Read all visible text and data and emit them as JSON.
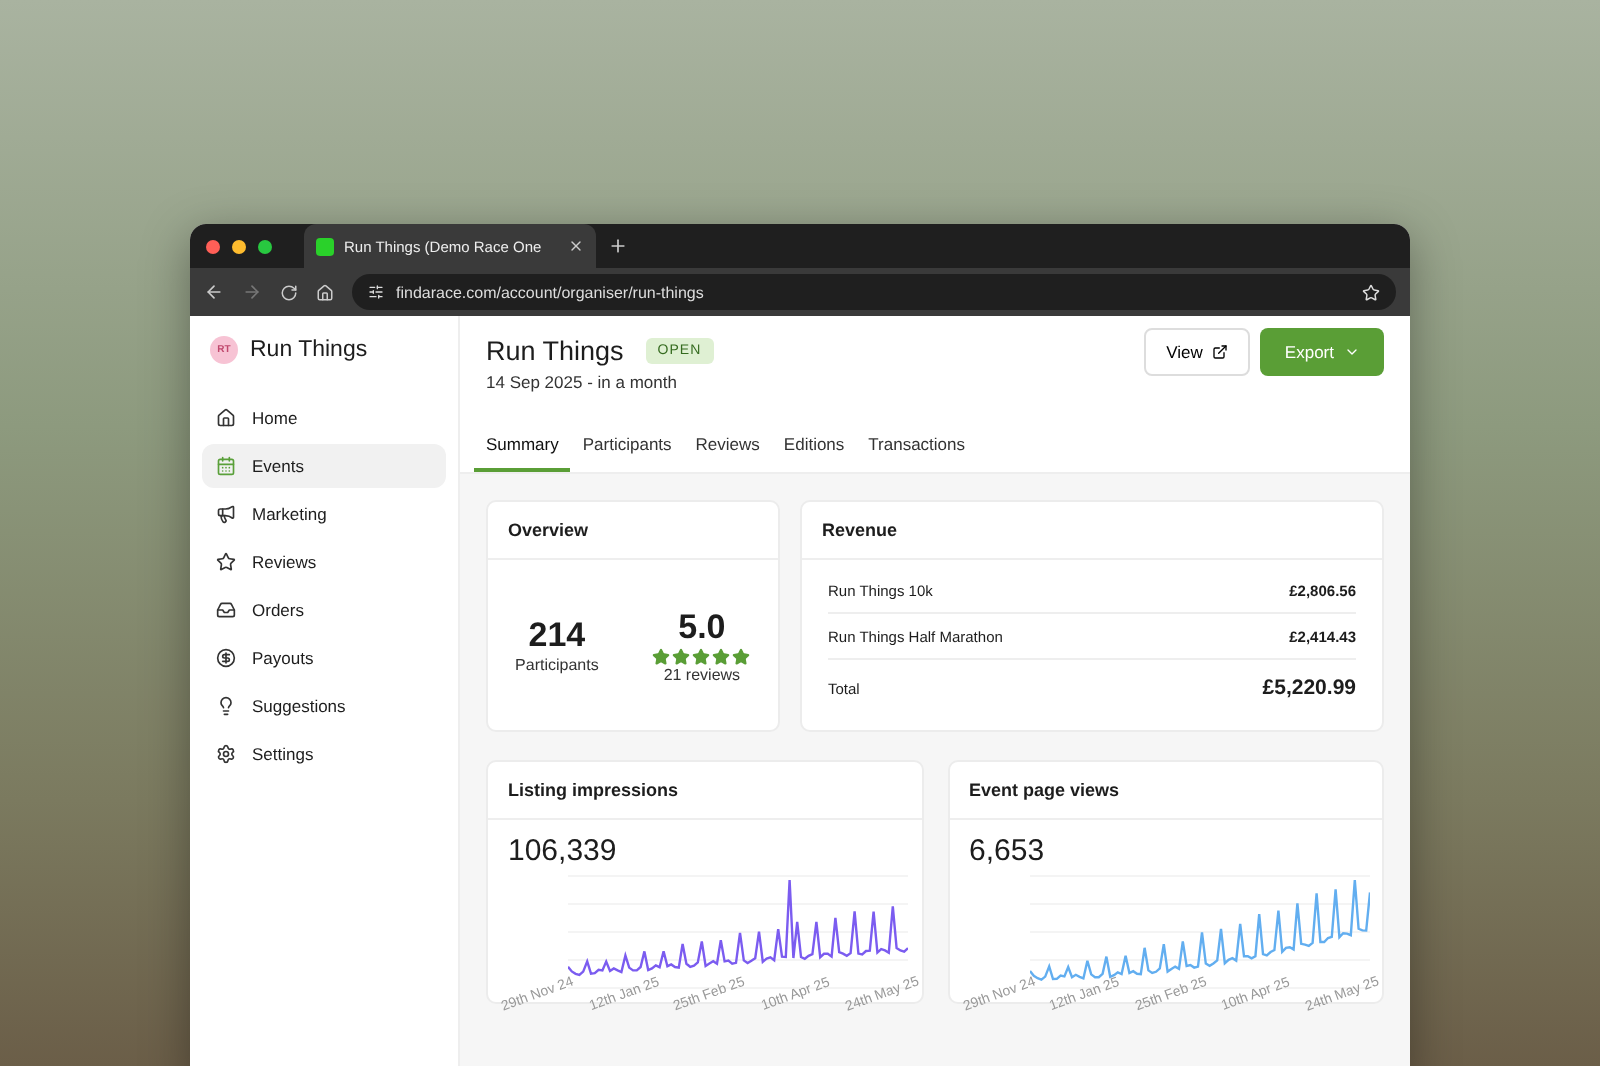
{
  "browser": {
    "tab_title": "Run Things (Demo Race One",
    "url": "findarace.com/account/organiser/run-things"
  },
  "sidebar": {
    "org_initials": "RT",
    "org_name": "Run Things",
    "items": [
      {
        "label": "Home",
        "selected": false
      },
      {
        "label": "Events",
        "selected": true
      },
      {
        "label": "Marketing",
        "selected": false
      },
      {
        "label": "Reviews",
        "selected": false
      },
      {
        "label": "Orders",
        "selected": false
      },
      {
        "label": "Payouts",
        "selected": false
      },
      {
        "label": "Suggestions",
        "selected": false
      },
      {
        "label": "Settings",
        "selected": false
      }
    ]
  },
  "event": {
    "title": "Run Things",
    "status": "OPEN",
    "date": "14 Sep 2025 - in a month"
  },
  "actions": {
    "view": "View",
    "export": "Export"
  },
  "tabs": [
    {
      "label": "Summary",
      "selected": true
    },
    {
      "label": "Participants",
      "selected": false
    },
    {
      "label": "Reviews",
      "selected": false
    },
    {
      "label": "Editions",
      "selected": false
    },
    {
      "label": "Transactions",
      "selected": false
    }
  ],
  "overview": {
    "title": "Overview",
    "participants_count": "214",
    "participants_label": "Participants",
    "rating": "5.0",
    "stars": 5,
    "reviews": "21 reviews"
  },
  "revenue": {
    "title": "Revenue",
    "rows": [
      {
        "label": "Run Things 10k",
        "amount": "£2,806.56"
      },
      {
        "label": "Run Things Half Marathon",
        "amount": "£2,414.43"
      }
    ],
    "total_label": "Total",
    "total": "£5,220.99"
  },
  "metrics": [
    {
      "title": "Listing impressions",
      "value": "106,339",
      "color": "#7b5cf0",
      "x_labels": [
        "29th Nov 24",
        "12th Jan 25",
        "25th Feb 25",
        "10th Apr 25",
        "24th May 25"
      ]
    },
    {
      "title": "Event page views",
      "value": "6,653",
      "color": "#62aef0",
      "x_labels": [
        "29th Nov 24",
        "12th Jan 25",
        "25th Feb 25",
        "10th Apr 25",
        "24th May 25"
      ]
    }
  ]
}
